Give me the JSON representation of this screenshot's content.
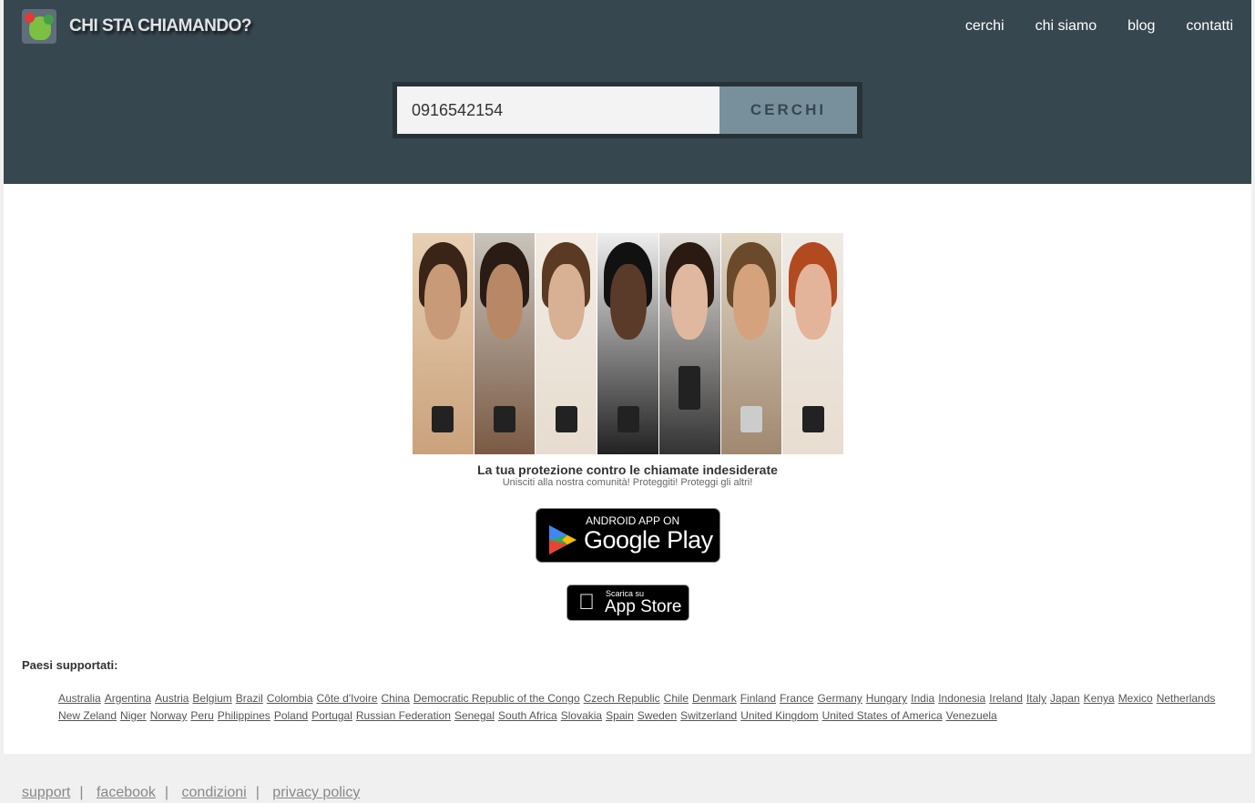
{
  "header": {
    "title": "CHI STA CHIAMANDO?",
    "nav": [
      "cerchi",
      "chi siamo",
      "blog",
      "contatti"
    ]
  },
  "search": {
    "value": "0916542154",
    "button": "CERCHI"
  },
  "promo": {
    "headline": "La tua protezione contro le chiamate indesiderate",
    "subline": "Unisciti alla nostra comunità! Proteggiti! Proteggi gli altri!",
    "google_play": {
      "small": "ANDROID APP ON",
      "big": "Google Play"
    },
    "app_store": {
      "small": "Scarica su",
      "big": "App Store"
    }
  },
  "countries": {
    "label": "Paesi supportati:",
    "items": [
      "Australia",
      "Argentina",
      "Austria",
      "Belgium",
      "Brazil",
      "Colombia",
      "Côte d'Ivoire",
      "China",
      "Democratic Republic of the Congo",
      "Czech Republic",
      "Chile",
      "Denmark",
      "Finland",
      "France",
      "Germany",
      "Hungary",
      "India",
      "Indonesia",
      "Ireland",
      "Italy",
      "Japan",
      "Kenya",
      "Mexico",
      "Netherlands",
      "New Zeland",
      "Niger",
      "Norway",
      "Peru",
      "Philippines",
      "Poland",
      "Portugal",
      "Russian Federation",
      "Senegal",
      "South Africa",
      "Slovakia",
      "Spain",
      "Sweden",
      "Switzerland",
      "United Kingdom",
      "United States of America",
      "Venezuela"
    ]
  },
  "footer": {
    "links": [
      "support",
      "facebook",
      "condizioni",
      "privacy policy"
    ]
  }
}
